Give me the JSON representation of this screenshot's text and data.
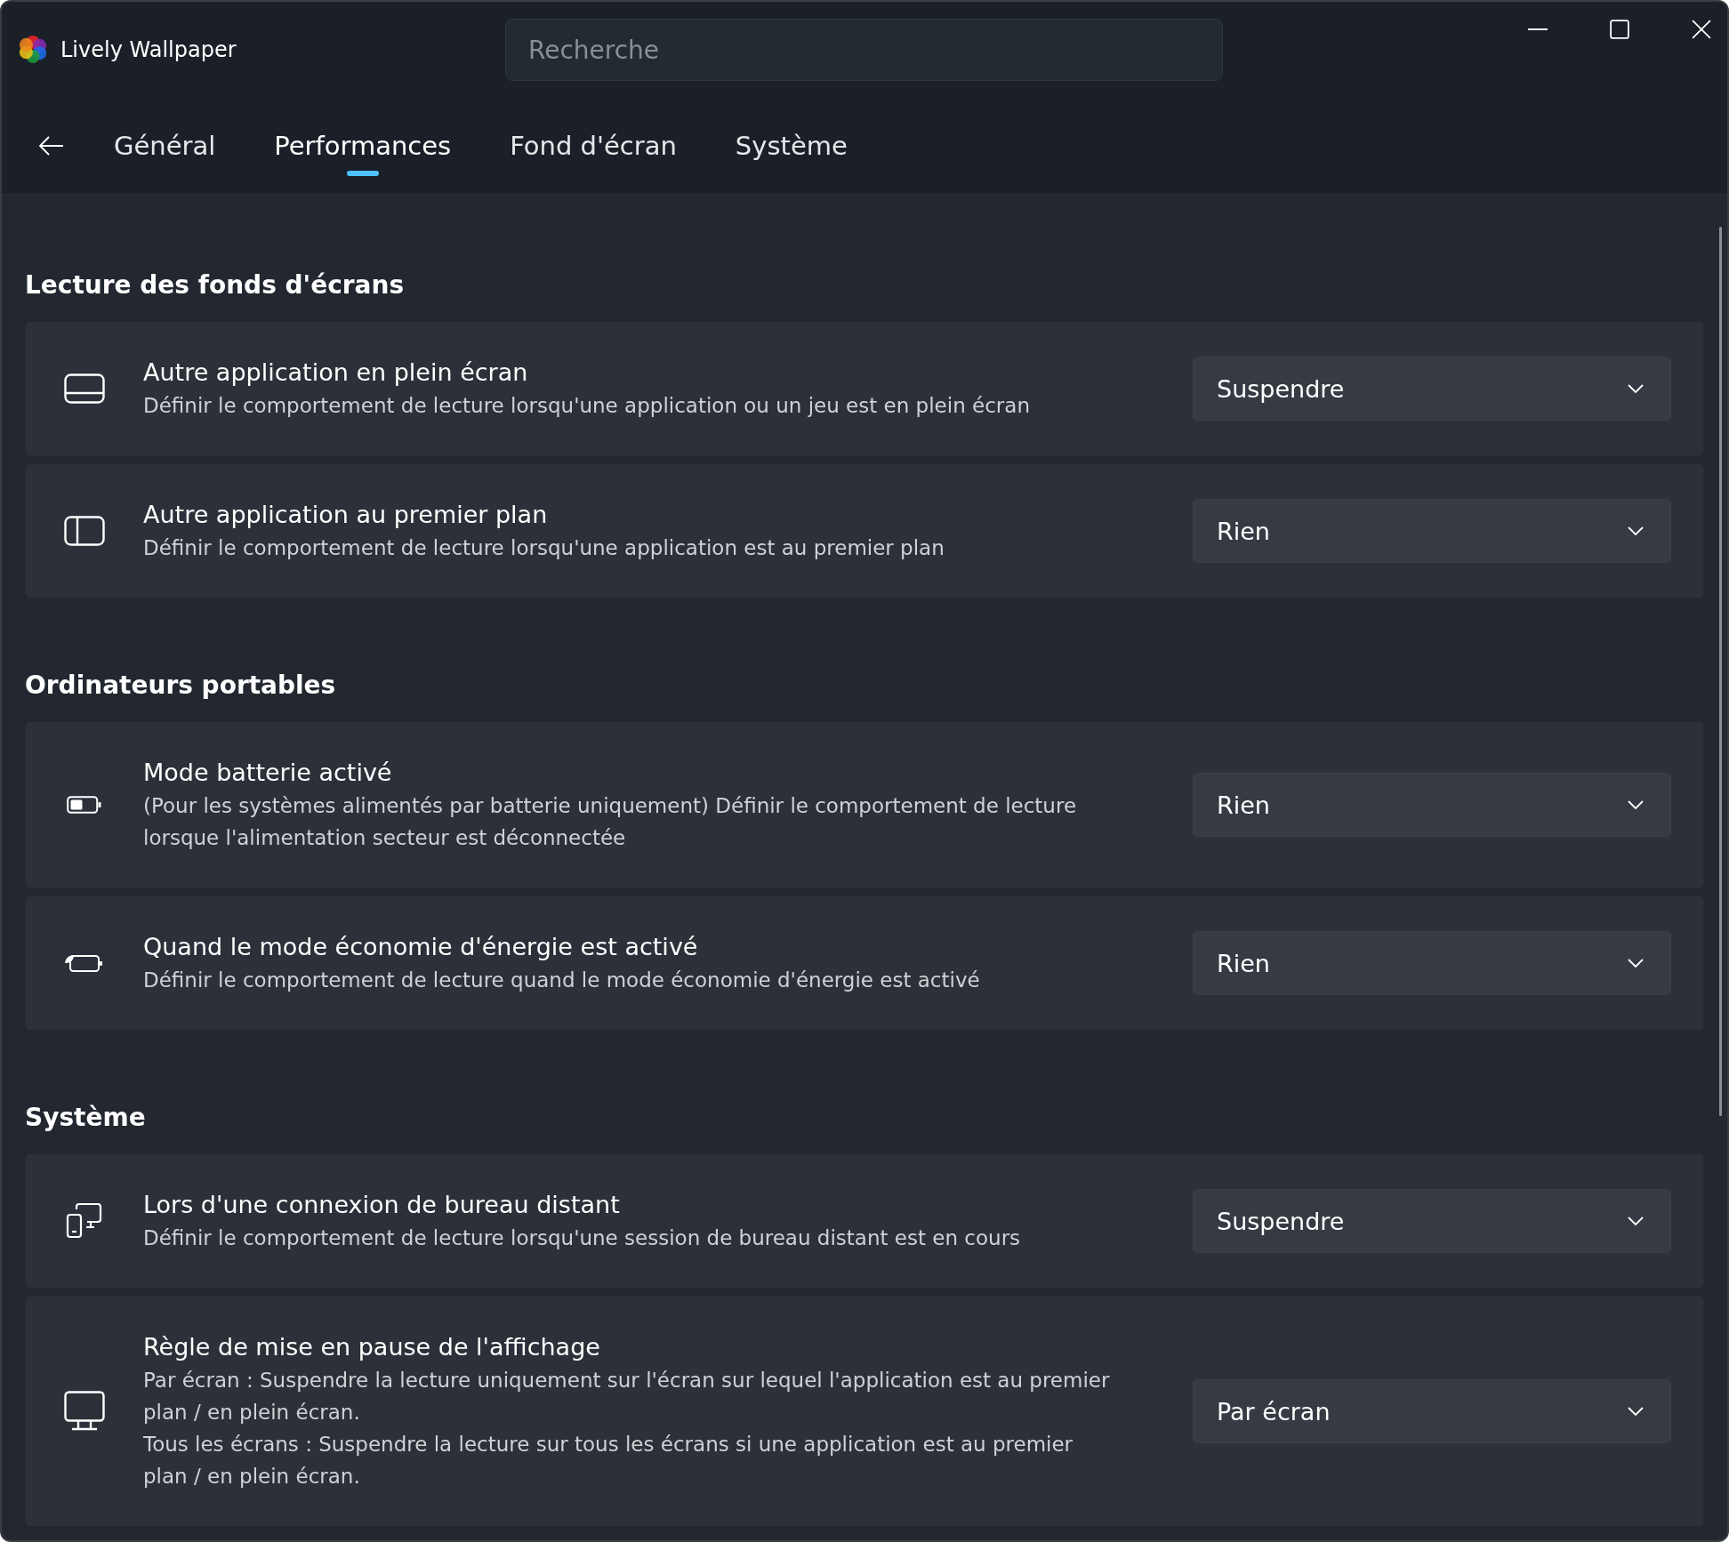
{
  "window": {
    "title": "Lively Wallpaper"
  },
  "search": {
    "placeholder": "Recherche"
  },
  "tabs": [
    {
      "label": "Général",
      "selected": false
    },
    {
      "label": "Performances",
      "selected": true
    },
    {
      "label": "Fond d'écran",
      "selected": false
    },
    {
      "label": "Système",
      "selected": false
    }
  ],
  "sections": [
    {
      "heading": "Lecture des fonds d'écrans",
      "settings": [
        {
          "kind": "fullscreen",
          "title": "Autre application en plein écran",
          "description": [
            "Définir le comportement de lecture lorsqu'une application ou un jeu est en plein écran"
          ],
          "value": "Suspendre"
        },
        {
          "kind": "sidepanel",
          "title": "Autre application au premier plan",
          "description": [
            "Définir le comportement de lecture lorsqu'une application est au premier plan"
          ],
          "value": "Rien"
        }
      ]
    },
    {
      "heading": "Ordinateurs portables",
      "settings": [
        {
          "kind": "battery",
          "title": "Mode batterie activé",
          "description": [
            "(Pour les systèmes alimentés par batterie uniquement) Définir le comportement de lecture lorsque l'alimentation secteur est déconnectée"
          ],
          "value": "Rien"
        },
        {
          "kind": "battery-saver",
          "title": "Quand le mode économie d'énergie est activé",
          "description": [
            "Définir le comportement de lecture quand le mode économie d'énergie est activé"
          ],
          "value": "Rien"
        }
      ]
    },
    {
      "heading": "Système",
      "settings": [
        {
          "kind": "remote",
          "title": "Lors d'une connexion de bureau distant",
          "description": [
            "Définir le comportement de lecture lorsqu'une session de bureau distant est en cours"
          ],
          "value": "Suspendre"
        },
        {
          "kind": "monitor",
          "title": "Règle de mise en pause de l'affichage",
          "description": [
            "Par écran : Suspendre la lecture uniquement sur l'écran sur lequel l'application est au premier plan / en plein écran.",
            "Tous les écrans : Suspendre la lecture sur tous les écrans si une application est au premier plan / en plein écran."
          ],
          "value": "Par écran"
        }
      ]
    }
  ]
}
